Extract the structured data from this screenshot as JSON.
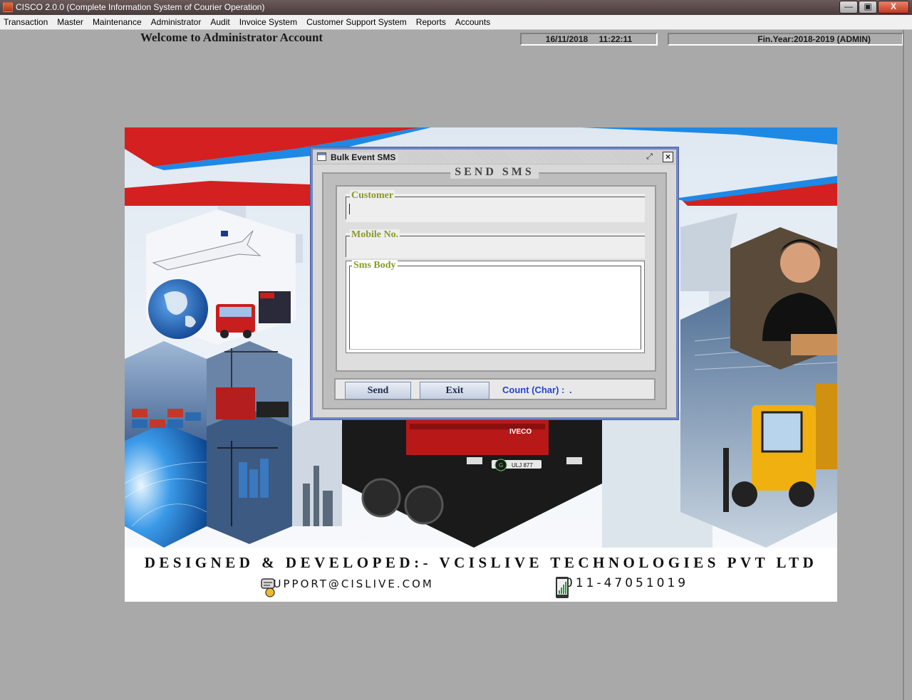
{
  "window": {
    "title": "CISCO 2.0.0 (Complete Information System of Courier Operation)",
    "min_label": "—",
    "max_label": "▣",
    "close_label": "X"
  },
  "menu": [
    {
      "label": "Transaction"
    },
    {
      "label": "Master"
    },
    {
      "label": "Maintenance"
    },
    {
      "label": "Administrator"
    },
    {
      "label": "Audit"
    },
    {
      "label": "Invoice System"
    },
    {
      "label": "Customer Support System"
    },
    {
      "label": "Reports"
    },
    {
      "label": "Accounts"
    }
  ],
  "header": {
    "welcome": "Welcome to Administrator Account",
    "date": "16/11/2018",
    "time": "11:22:11",
    "fin_year": "Fin.Year:2018-2019  (ADMIN)"
  },
  "banner": {
    "credit": "DESIGNED & DEVELOPED:- VCISLIVE TECHNOLOGIES PVT LTD",
    "support_email": "SUPPORT@CISLIVE.COM",
    "phone": "011-47051019",
    "truck_brand": "IVECO",
    "plate": "ULJ 877",
    "plate_badge": "G"
  },
  "dialog": {
    "title": "Bulk Event SMS",
    "restore_label": "⤢",
    "close_label": "×",
    "section_title": "SEND SMS",
    "customer": {
      "label": "Customer",
      "value": ""
    },
    "mobile": {
      "label": "Mobile No.",
      "value": ""
    },
    "sms_body": {
      "label": "Sms Body",
      "value": ""
    },
    "send_label": "Send",
    "exit_label": "Exit",
    "count_label": "Count (Char) :",
    "count_value": "."
  },
  "colors": {
    "dialog_frame": "#6e86c3",
    "field_label": "#8a9a28",
    "count_text": "#2346c8",
    "banner_red": "#d42020",
    "banner_blue": "#1e88e5"
  }
}
